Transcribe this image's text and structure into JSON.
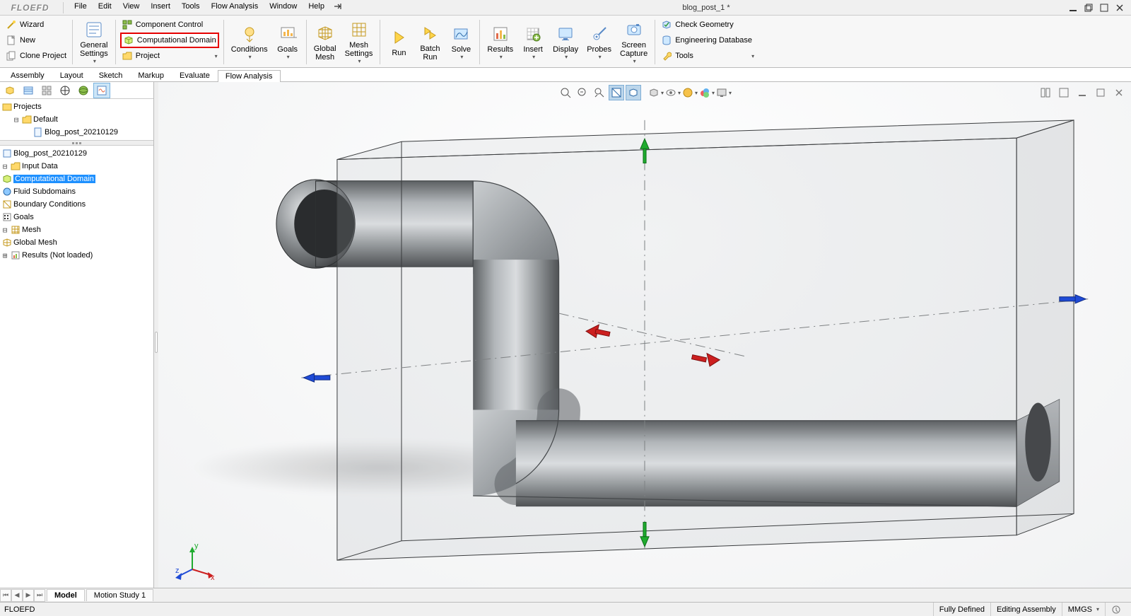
{
  "app": {
    "logo": "FLOEFD",
    "doc_title": "blog_post_1 *"
  },
  "menus": [
    "File",
    "Edit",
    "View",
    "Insert",
    "Tools",
    "Flow Analysis",
    "Window",
    "Help"
  ],
  "ribbon": {
    "left": {
      "wizard": "Wizard",
      "new": "New",
      "clone": "Clone Project"
    },
    "general": {
      "top": "General",
      "bottom": "Settings"
    },
    "components": {
      "control": "Component Control",
      "domain": "Computational Domain",
      "project": "Project"
    },
    "conditions": "Conditions",
    "goals": "Goals",
    "global_mesh": {
      "top": "Global",
      "bottom": "Mesh"
    },
    "mesh_settings": {
      "top": "Mesh",
      "bottom": "Settings"
    },
    "run": "Run",
    "batch_run": {
      "top": "Batch",
      "bottom": "Run"
    },
    "solve": "Solve",
    "results": "Results",
    "insert": "Insert",
    "display": "Display",
    "probes": "Probes",
    "screen_capture": {
      "top": "Screen",
      "bottom": "Capture"
    },
    "tools_panel": {
      "check": "Check Geometry",
      "db": "Engineering Database",
      "tools": "Tools"
    }
  },
  "tabs": [
    "Assembly",
    "Layout",
    "Sketch",
    "Markup",
    "Evaluate",
    "Flow Analysis"
  ],
  "active_tab_index": 5,
  "tree1": {
    "root": "Projects",
    "default": "Default",
    "blog": "Blog_post_20210129"
  },
  "tree2": {
    "root": "Blog_post_20210129",
    "input": "Input Data",
    "comp_domain": "Computational Domain",
    "fluid_sub": "Fluid Subdomains",
    "boundary": "Boundary Conditions",
    "goals": "Goals",
    "mesh": "Mesh",
    "global_mesh": "Global Mesh",
    "results": "Results (Not loaded)"
  },
  "bottom_tabs": [
    "Model",
    "Motion Study 1"
  ],
  "status": {
    "left": "FLOEFD",
    "fully_defined": "Fully Defined",
    "editing": "Editing Assembly",
    "units": "MMGS"
  },
  "triad": {
    "x": "x",
    "y": "y",
    "z": "z"
  }
}
